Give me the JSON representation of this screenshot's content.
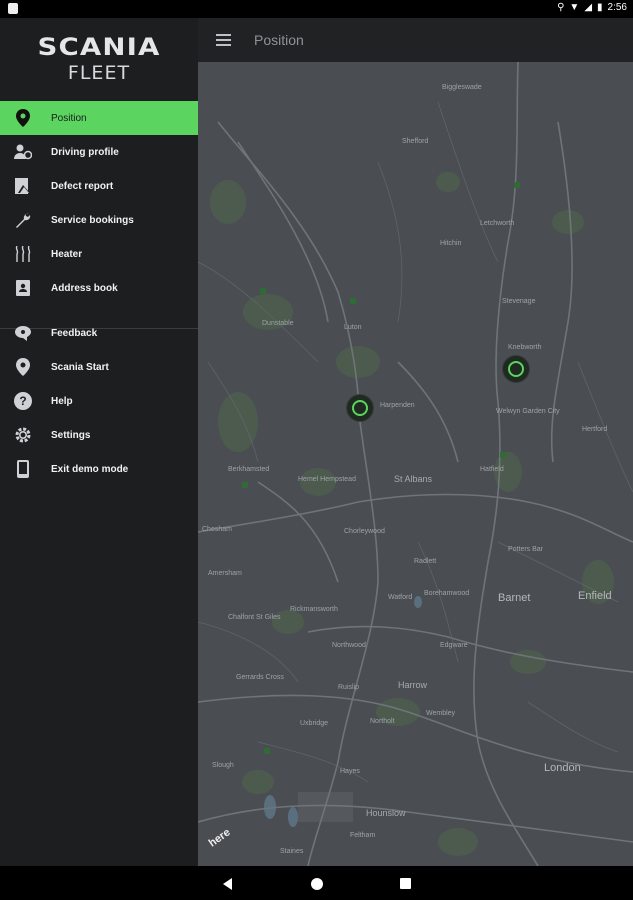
{
  "status_bar": {
    "time": "2:56"
  },
  "app": {
    "logo_line1": "SCANIA",
    "logo_line2": "FLEET",
    "accent_color": "#5bd460"
  },
  "toolbar": {
    "title": "Position",
    "menu_icon": "hamburger-icon"
  },
  "drawer": {
    "primary_items": [
      {
        "label": "Position",
        "icon": "location-pin-icon",
        "active": true
      },
      {
        "label": "Driving profile",
        "icon": "driver-profile-icon",
        "active": false
      },
      {
        "label": "Defect report",
        "icon": "defect-report-icon",
        "active": false
      },
      {
        "label": "Service bookings",
        "icon": "wrench-icon",
        "active": false
      },
      {
        "label": "Heater",
        "icon": "heater-icon",
        "active": false
      },
      {
        "label": "Address book",
        "icon": "address-book-icon",
        "active": false
      }
    ],
    "secondary_items": [
      {
        "label": "Feedback",
        "icon": "feedback-icon"
      },
      {
        "label": "Scania Start",
        "icon": "location-pin-icon"
      },
      {
        "label": "Help",
        "icon": "help-icon"
      },
      {
        "label": "Settings",
        "icon": "gear-icon"
      },
      {
        "label": "Exit demo mode",
        "icon": "phone-icon"
      }
    ]
  },
  "map": {
    "provider": "here",
    "places": [
      "Biggleswade",
      "Shefford",
      "Letchworth",
      "Hitchin",
      "Stevenage",
      "Knebworth",
      "Dunstable",
      "Luton",
      "Harpenden",
      "Welwyn Garden City",
      "Hertford",
      "Berkhamsted",
      "Hemel Hempstead",
      "St Albans",
      "Hatfield",
      "Chesham",
      "Amersham",
      "Chalfont St Giles",
      "Chorleywood",
      "Radlett",
      "Potters Bar",
      "Rickmansworth",
      "Watford",
      "Borehamwood",
      "Barnet",
      "Enfield",
      "Northwood",
      "Edgware",
      "Gerrards Cross",
      "Ruislip",
      "Harrow",
      "Uxbridge",
      "Northolt",
      "Wembley",
      "Slough",
      "Hayes",
      "London",
      "Hounslow",
      "Feltham",
      "Staines"
    ]
  }
}
